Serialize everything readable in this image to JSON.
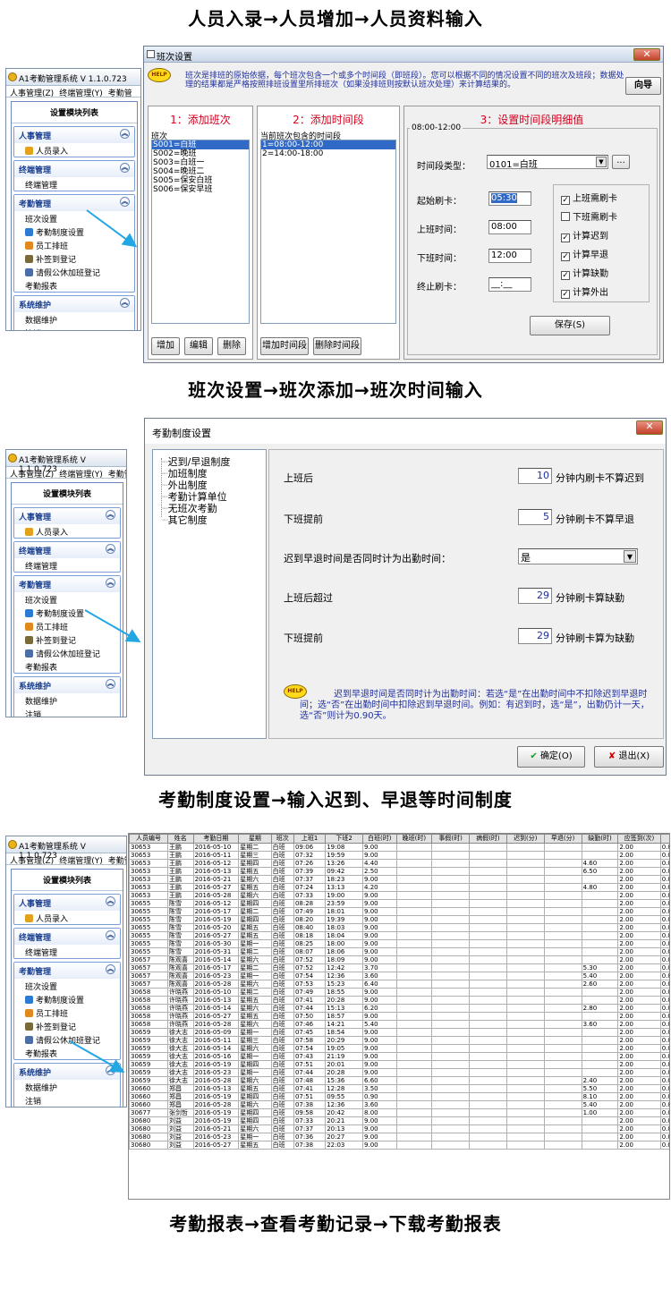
{
  "captions": {
    "c1": "人员入录→人员增加→人员资料输入",
    "c2": "班次设置→班次添加→班次时间输入",
    "c3": "考勤制度设置→输入迟到、早退等时间制度",
    "c4": "考勤报表→查看考勤记录→下载考勤报表"
  },
  "app": {
    "title": "A1考勤管理系统 V 1.1.0.723",
    "menu": [
      "人事管理(Z)",
      "终端管理(Y)",
      "考勤管"
    ],
    "menu2": [
      "人事管理(Z)",
      "终端管理(Y)",
      "考勤管"
    ],
    "list_header": "设置模块列表",
    "groups": [
      {
        "title": "人事管理",
        "items": [
          "人员录入"
        ]
      },
      {
        "title": "终端管理",
        "items": [
          "终端管理"
        ]
      },
      {
        "title": "考勤管理",
        "items": [
          "班次设置",
          "考勤制度设置",
          "员工排班",
          "补签到登记",
          "请假公休加班登记",
          "考勤报表"
        ]
      },
      {
        "title": "系统维护",
        "items": [
          "数据维护",
          "注销"
        ]
      }
    ]
  },
  "shift": {
    "title": "班次设置",
    "help_badge": "HELP",
    "help_text": "班次是排班的原始依据，每个班次包含一个或多个时间段（即班段）。您可以根据不同的情况设置不同的班次及班段；数据处理的结果都是严格按照排班设置里所排班次（如果没排班则按默认班次处理）来计算结果的。",
    "guide_button": "向导",
    "sec1": "1：添加班次",
    "sec2": "2：添加时间段",
    "sec3": "3：设置时间段明细值",
    "shifts_label": "班次",
    "shifts": [
      "S001=白班",
      "S002=晚班",
      "S003=白班一",
      "S004=晚班二",
      "S005=保安白班",
      "S006=保安早班"
    ],
    "periods_label": "当前班次包含的时间段",
    "periods": [
      "1=08:00-12:00",
      "2=14:00-18:00"
    ],
    "group_title": "08:00-12:00",
    "type_label": "时间段类型：",
    "type_value": "0101=白班",
    "type_btn": "...",
    "fields": [
      {
        "label": "起始刷卡：",
        "value": "05:30"
      },
      {
        "label": "上班时间：",
        "value": "08:00"
      },
      {
        "label": "下班时间：",
        "value": "12:00"
      },
      {
        "label": "终止刷卡：",
        "value": "__:__"
      }
    ],
    "checks": [
      {
        "label": "上班需刷卡",
        "mark": "✓"
      },
      {
        "label": "下班需刷卡",
        "mark": ""
      },
      {
        "label": "计算迟到",
        "mark": "✓"
      },
      {
        "label": "计算早退",
        "mark": "✓"
      },
      {
        "label": "计算缺勤",
        "mark": "✓"
      },
      {
        "label": "计算外出",
        "mark": "✓"
      }
    ],
    "save": "保存(S)",
    "btn_add": "增加",
    "btn_edit": "编辑",
    "btn_del": "删除",
    "btn_add_period": "增加时间段",
    "btn_del_period": "删除时间段"
  },
  "rules": {
    "title": "考勤制度设置",
    "tree": [
      "迟到/早退制度",
      "加班制度",
      "外出制度",
      "考勤计算单位",
      "无班次考勤",
      "其它制度"
    ],
    "rows": [
      {
        "label": "上班后",
        "value": "10",
        "suffix": "分钟内刷卡不算迟到"
      },
      {
        "label": "下班提前",
        "value": "5",
        "suffix": "分钟刷卡不算早退"
      },
      {
        "label": "迟到早退时间是否同时计为出勤时间：",
        "value": "是",
        "suffix": ""
      },
      {
        "label": "上班后超过",
        "value": "29",
        "suffix": "分钟刷卡算缺勤"
      },
      {
        "label": "下班提前",
        "value": "29",
        "suffix": "分钟刷卡算为缺勤"
      }
    ],
    "help_text": "迟到早退时间是否同时计为出勤时间：若选“是”在出勤时间中不扣除迟到早退时间；选“否”在出勤时间中扣除迟到早退时间。例如：有迟到时，选“是”，出勤仍计一天，选“否”则计为0.90天。",
    "ok": "确定(O)",
    "exit": "退出(X)"
  },
  "report": {
    "headers": [
      "人员编号",
      "姓名",
      "考勤日期",
      "星期",
      "班次",
      "上班1",
      "下班2",
      "白班(时)",
      "晚班(时)",
      "事假(时)",
      "病假(时)",
      "迟到(分)",
      "早退(分)",
      "缺勤(时)",
      "应签到(次)",
      "未签到("
    ],
    "rows": [
      [
        "30653",
        "王鹏",
        "2016-05-10",
        "星期二",
        "白班",
        "09:06",
        "19:08",
        "9.00",
        "",
        "",
        "",
        "",
        "",
        "",
        "2.00",
        "0.00"
      ],
      [
        "30653",
        "王鹏",
        "2016-05-11",
        "星期三",
        "白班",
        "07:32",
        "19:59",
        "9.00",
        "",
        "",
        "",
        "",
        "",
        "",
        "2.00",
        "0.00"
      ],
      [
        "30653",
        "王鹏",
        "2016-05-12",
        "星期四",
        "白班",
        "07:26",
        "13:26",
        "4.40",
        "",
        "",
        "",
        "",
        "",
        "4.60",
        "2.00",
        "0.00"
      ],
      [
        "30653",
        "王鹏",
        "2016-05-13",
        "星期五",
        "白班",
        "07:39",
        "09:42",
        "2.50",
        "",
        "",
        "",
        "",
        "",
        "6.50",
        "2.00",
        "0.00"
      ],
      [
        "30653",
        "王鹏",
        "2016-05-21",
        "星期六",
        "白班",
        "07:37",
        "18:23",
        "9.00",
        "",
        "",
        "",
        "",
        "",
        "",
        "2.00",
        "0.00"
      ],
      [
        "30653",
        "王鹏",
        "2016-05-27",
        "星期五",
        "白班",
        "07:24",
        "13:13",
        "4.20",
        "",
        "",
        "",
        "",
        "",
        "4.80",
        "2.00",
        "0.00"
      ],
      [
        "30653",
        "王鹏",
        "2016-05-28",
        "星期六",
        "白班",
        "07:33",
        "19:00",
        "9.00",
        "",
        "",
        "",
        "",
        "",
        "",
        "2.00",
        "0.00"
      ],
      [
        "30655",
        "陈雪",
        "2016-05-12",
        "星期四",
        "白班",
        "08:28",
        "23:59",
        "9.00",
        "",
        "",
        "",
        "",
        "",
        "",
        "2.00",
        "0.00"
      ],
      [
        "30655",
        "陈雪",
        "2016-05-17",
        "星期二",
        "白班",
        "07:49",
        "18:01",
        "9.00",
        "",
        "",
        "",
        "",
        "",
        "",
        "2.00",
        "0.00"
      ],
      [
        "30655",
        "陈雪",
        "2016-05-19",
        "星期四",
        "白班",
        "08:20",
        "19:39",
        "9.00",
        "",
        "",
        "",
        "",
        "",
        "",
        "2.00",
        "0.00"
      ],
      [
        "30655",
        "陈雪",
        "2016-05-20",
        "星期五",
        "白班",
        "08:40",
        "18:03",
        "9.00",
        "",
        "",
        "",
        "",
        "",
        "",
        "2.00",
        "0.00"
      ],
      [
        "30655",
        "陈雪",
        "2016-05-27",
        "星期五",
        "白班",
        "08:18",
        "18:04",
        "9.00",
        "",
        "",
        "",
        "",
        "",
        "",
        "2.00",
        "0.00"
      ],
      [
        "30655",
        "陈雪",
        "2016-05-30",
        "星期一",
        "白班",
        "08:25",
        "18:00",
        "9.00",
        "",
        "",
        "",
        "",
        "",
        "",
        "2.00",
        "0.00"
      ],
      [
        "30655",
        "陈雪",
        "2016-05-31",
        "星期二",
        "白班",
        "08:07",
        "18:06",
        "9.00",
        "",
        "",
        "",
        "",
        "",
        "",
        "2.00",
        "0.00"
      ],
      [
        "30657",
        "陈观喜",
        "2016-05-14",
        "星期六",
        "白班",
        "07:52",
        "18:09",
        "9.00",
        "",
        "",
        "",
        "",
        "",
        "",
        "2.00",
        "0.00"
      ],
      [
        "30657",
        "陈观喜",
        "2016-05-17",
        "星期二",
        "白班",
        "07:52",
        "12:42",
        "3.70",
        "",
        "",
        "",
        "",
        "",
        "5.30",
        "2.00",
        "0.00"
      ],
      [
        "30657",
        "陈观喜",
        "2016-05-23",
        "星期一",
        "白班",
        "07:54",
        "12:36",
        "3.60",
        "",
        "",
        "",
        "",
        "",
        "5.40",
        "2.00",
        "0.00"
      ],
      [
        "30657",
        "陈观喜",
        "2016-05-28",
        "星期六",
        "白班",
        "07:53",
        "15:23",
        "6.40",
        "",
        "",
        "",
        "",
        "",
        "2.60",
        "2.00",
        "0.00"
      ],
      [
        "30658",
        "许晓燕",
        "2016-05-10",
        "星期二",
        "白班",
        "07:49",
        "18:55",
        "9.00",
        "",
        "",
        "",
        "",
        "",
        "",
        "2.00",
        "0.00"
      ],
      [
        "30658",
        "许晓燕",
        "2016-05-13",
        "星期五",
        "白班",
        "07:41",
        "20:28",
        "9.00",
        "",
        "",
        "",
        "",
        "",
        "",
        "2.00",
        "0.00"
      ],
      [
        "30658",
        "许晓燕",
        "2016-05-14",
        "星期六",
        "白班",
        "07:44",
        "15:13",
        "6.20",
        "",
        "",
        "",
        "",
        "",
        "2.80",
        "2.00",
        "0.00"
      ],
      [
        "30658",
        "许晓燕",
        "2016-05-27",
        "星期五",
        "白班",
        "07:50",
        "18:57",
        "9.00",
        "",
        "",
        "",
        "",
        "",
        "",
        "2.00",
        "0.00"
      ],
      [
        "30658",
        "许晓燕",
        "2016-05-28",
        "星期六",
        "白班",
        "07:46",
        "14:21",
        "5.40",
        "",
        "",
        "",
        "",
        "",
        "3.60",
        "2.00",
        "0.00"
      ],
      [
        "30659",
        "徐大志",
        "2016-05-09",
        "星期一",
        "白班",
        "07:45",
        "18:54",
        "9.00",
        "",
        "",
        "",
        "",
        "",
        "",
        "2.00",
        "0.00"
      ],
      [
        "30659",
        "徐大志",
        "2016-05-11",
        "星期三",
        "白班",
        "07:58",
        "20:29",
        "9.00",
        "",
        "",
        "",
        "",
        "",
        "",
        "2.00",
        "0.00"
      ],
      [
        "30659",
        "徐大志",
        "2016-05-14",
        "星期六",
        "白班",
        "07:54",
        "19:05",
        "9.00",
        "",
        "",
        "",
        "",
        "",
        "",
        "2.00",
        "0.00"
      ],
      [
        "30659",
        "徐大志",
        "2016-05-16",
        "星期一",
        "白班",
        "07:43",
        "21:19",
        "9.00",
        "",
        "",
        "",
        "",
        "",
        "",
        "2.00",
        "0.00"
      ],
      [
        "30659",
        "徐大志",
        "2016-05-19",
        "星期四",
        "白班",
        "07:51",
        "20:01",
        "9.00",
        "",
        "",
        "",
        "",
        "",
        "",
        "2.00",
        "0.00"
      ],
      [
        "30659",
        "徐大志",
        "2016-05-23",
        "星期一",
        "白班",
        "07:44",
        "20:28",
        "9.00",
        "",
        "",
        "",
        "",
        "",
        "",
        "2.00",
        "0.00"
      ],
      [
        "30659",
        "徐大志",
        "2016-05-28",
        "星期六",
        "白班",
        "07:48",
        "15:36",
        "6.60",
        "",
        "",
        "",
        "",
        "",
        "2.40",
        "2.00",
        "0.00"
      ],
      [
        "30660",
        "郑昌",
        "2016-05-13",
        "星期五",
        "白班",
        "07:41",
        "12:28",
        "3.50",
        "",
        "",
        "",
        "",
        "",
        "5.50",
        "2.00",
        "0.00"
      ],
      [
        "30660",
        "郑昌",
        "2016-05-19",
        "星期四",
        "白班",
        "07:51",
        "09:55",
        "0.90",
        "",
        "",
        "",
        "",
        "",
        "8.10",
        "2.00",
        "0.00"
      ],
      [
        "30660",
        "郑昌",
        "2016-05-28",
        "星期六",
        "白班",
        "07:38",
        "12:36",
        "3.60",
        "",
        "",
        "",
        "",
        "",
        "5.40",
        "2.00",
        "0.00"
      ],
      [
        "30677",
        "张剑哲",
        "2016-05-19",
        "星期四",
        "白班",
        "09:58",
        "20:42",
        "8.00",
        "",
        "",
        "",
        "",
        "",
        "1.00",
        "2.00",
        "0.00"
      ],
      [
        "30680",
        "刘益",
        "2016-05-19",
        "星期四",
        "白班",
        "07:33",
        "20:21",
        "9.00",
        "",
        "",
        "",
        "",
        "",
        "",
        "2.00",
        "0.00"
      ],
      [
        "30680",
        "刘益",
        "2016-05-21",
        "星期六",
        "白班",
        "07:37",
        "20:13",
        "9.00",
        "",
        "",
        "",
        "",
        "",
        "",
        "2.00",
        "0.00"
      ],
      [
        "30680",
        "刘益",
        "2016-05-23",
        "星期一",
        "白班",
        "07:36",
        "20:27",
        "9.00",
        "",
        "",
        "",
        "",
        "",
        "",
        "2.00",
        "0.00"
      ],
      [
        "30680",
        "刘益",
        "2016-05-27",
        "星期五",
        "白班",
        "07:38",
        "22:03",
        "9.00",
        "",
        "",
        "",
        "",
        "",
        "",
        "2.00",
        "0.00"
      ]
    ]
  },
  "colors": {
    "accent_blue": "#1d3f93",
    "arrow": "#23a7e3",
    "section_title": "#d2001e"
  }
}
